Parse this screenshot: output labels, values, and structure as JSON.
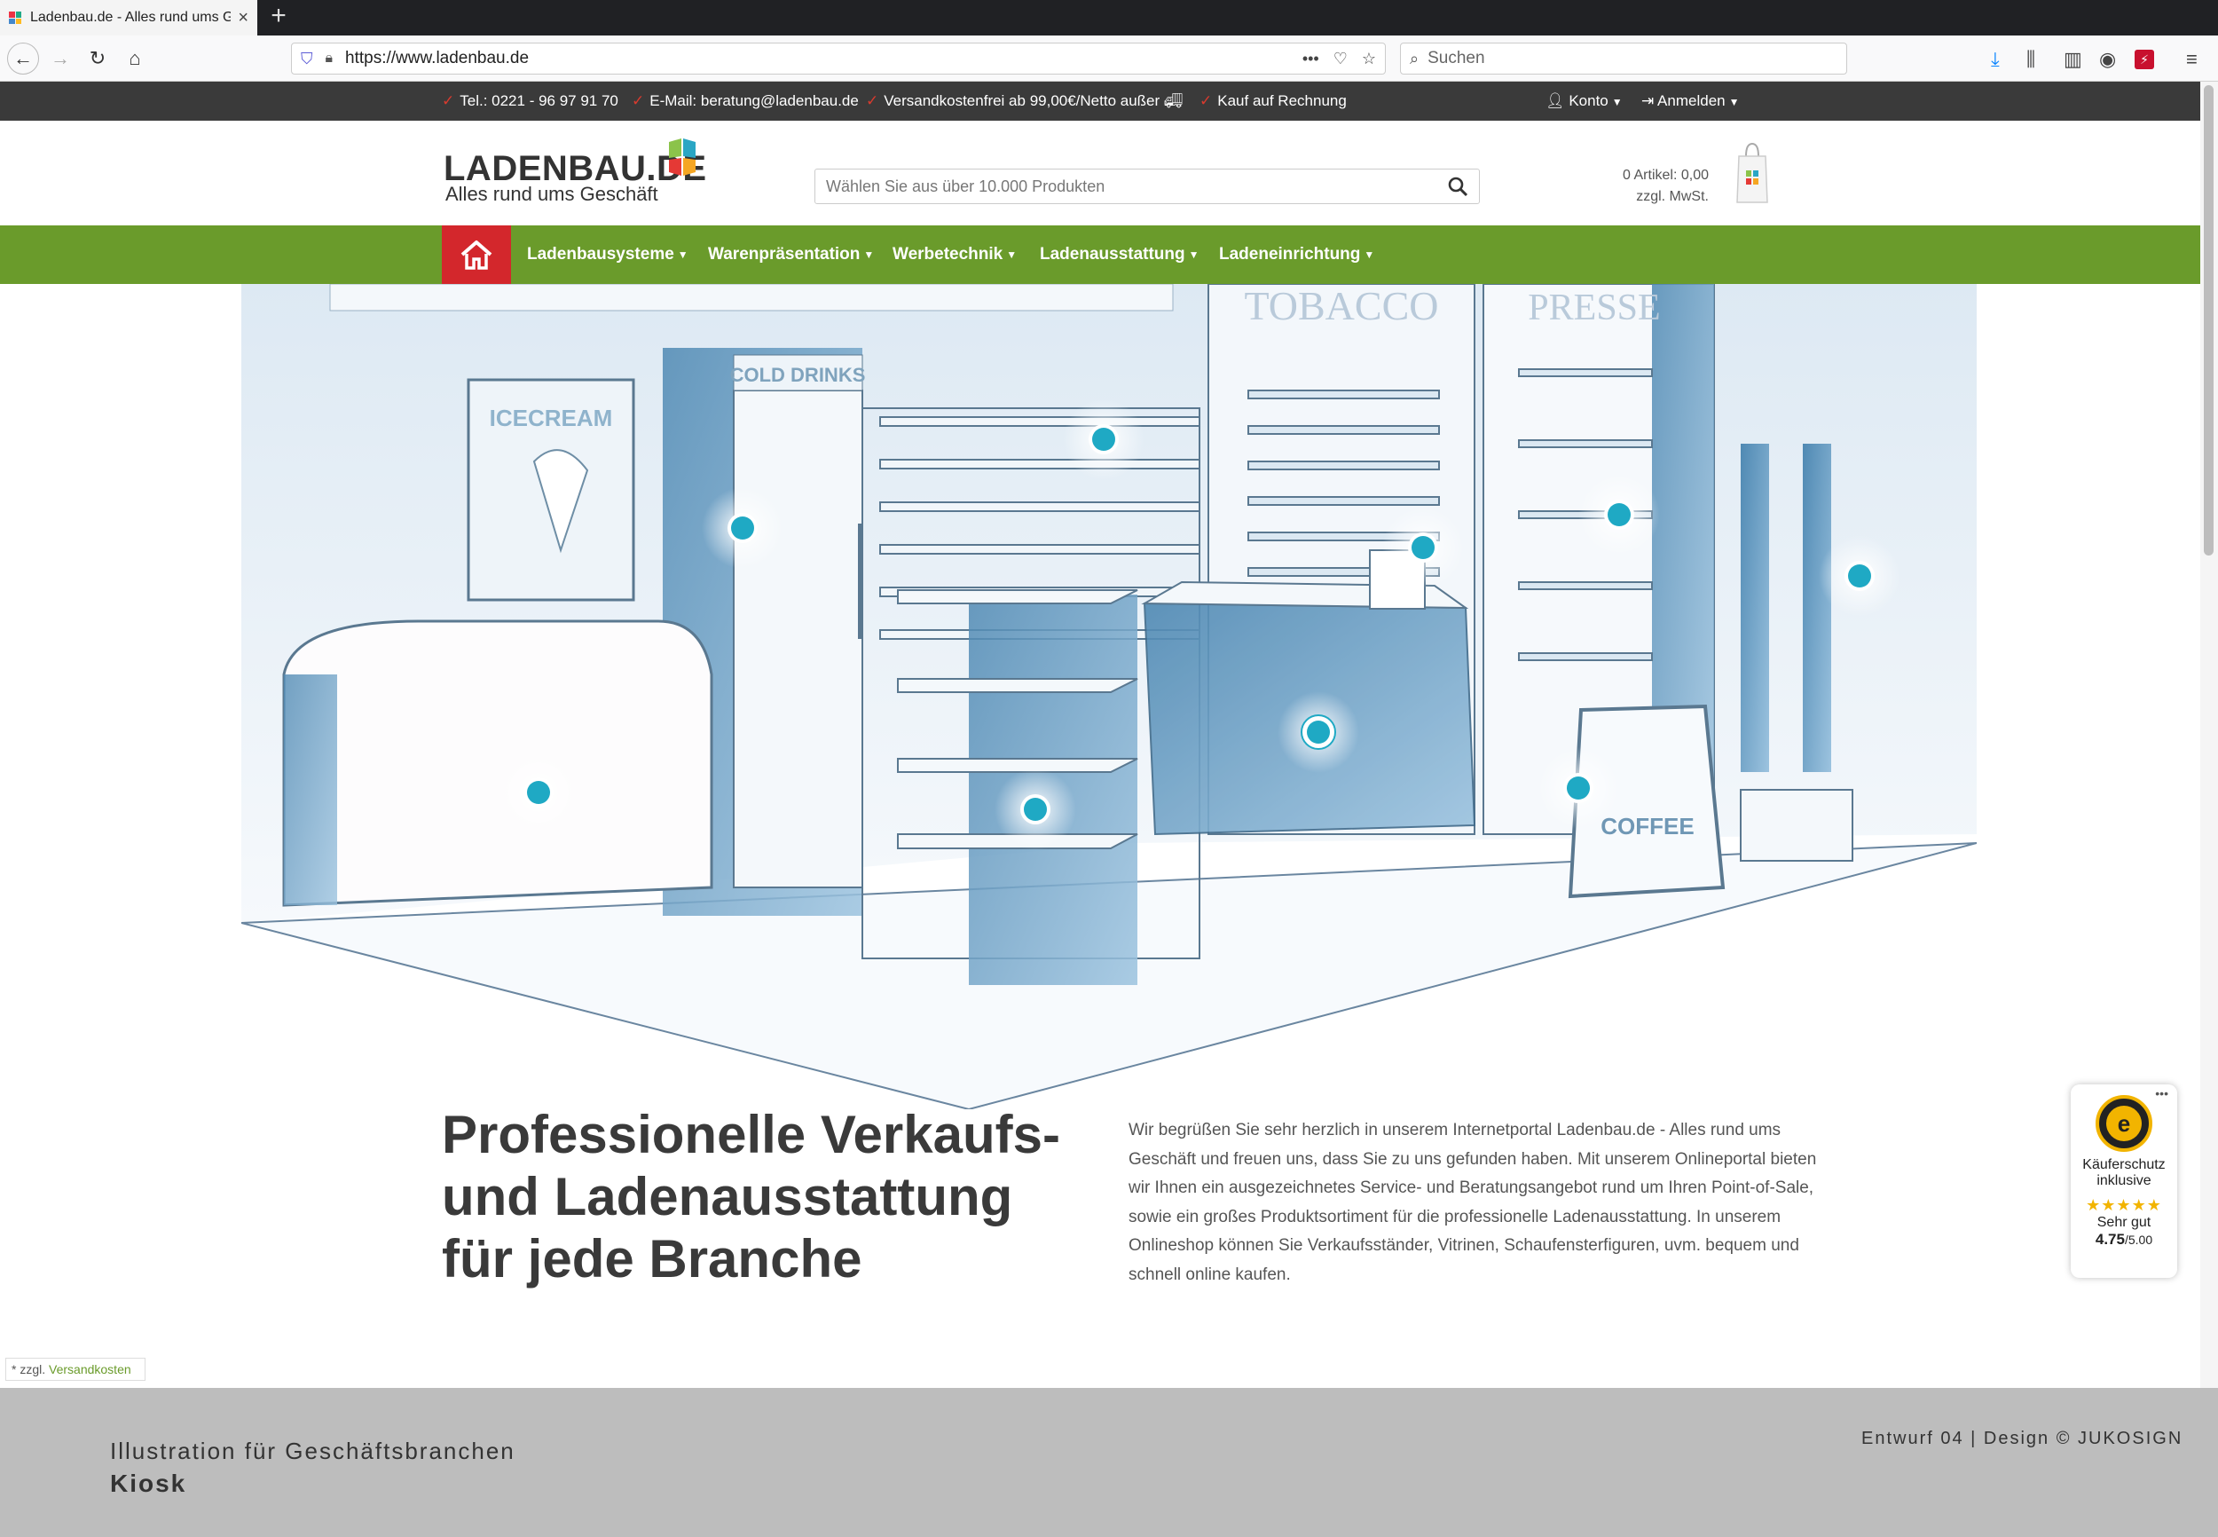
{
  "browser": {
    "tab_title": "Ladenbau.de - Alles rund ums G",
    "url": "https://www.ladenbau.de",
    "search_placeholder": "Suchen",
    "more_icon": "•••"
  },
  "topbar": {
    "phone": "Tel.: 0221 - 96 97 91 70",
    "email": "E-Mail: beratung@ladenbau.de",
    "shipping": "Versandkostenfrei ab 99,00€/Netto außer",
    "invoice": "Kauf auf Rechnung",
    "account": "Konto",
    "login": "Anmelden"
  },
  "header": {
    "logo": "LADENBAU.DE",
    "tagline": "Alles rund ums Geschäft",
    "search_placeholder": "Wählen Sie aus über 10.000 Produkten",
    "cart_line1": "0 Artikel: 0,00",
    "cart_line2": "zzgl. MwSt."
  },
  "nav": {
    "items": [
      "Ladenbausysteme",
      "Warenpräsentation",
      "Werbetechnik",
      "Ladenausstattung",
      "Ladeneinrichtung"
    ]
  },
  "hero": {
    "signs": {
      "tobacco": "TOBACCO",
      "presse": "PRESSE",
      "cold_drinks": "COLD DRINKS",
      "icecream": "ICECREAM",
      "coffee": "COFFEE"
    }
  },
  "content": {
    "headline": "Professionelle Verkaufs- und Ladenausstattung für jede Branche",
    "intro": "Wir begrüßen Sie sehr herzlich in unserem Internetportal Ladenbau.de - Alles rund ums Geschäft und freuen uns, dass Sie zu uns gefunden haben. Mit unserem Onlineportal bieten wir Ihnen ein ausgezeichnetes Service- und Beratungsangebot rund um Ihren Point-of-Sale, sowie ein großes Produktsortiment für die professionelle Ladenausstattung. In unserem Onlineshop können Sie Verkaufsständer, Vitrinen, Schaufensterfiguren, uvm. bequem und schnell online kaufen.",
    "footnote_prefix": "* zzgl.",
    "footnote_link": "Versandkosten"
  },
  "trusted": {
    "dots": "•••",
    "seal_letter": "e",
    "line1": "Käuferschutz",
    "line2": "inklusive",
    "stars": "★★★★★",
    "rating_label": "Sehr gut",
    "rating": "4.75",
    "rating_max": "/5.00"
  },
  "band": {
    "line1": "Illustration für Geschäftsbranchen",
    "line2": "Kiosk",
    "right": "Entwurf 04 | Design © JUKOSIGN"
  },
  "colors": {
    "nav_green": "#6a9b2b",
    "home_red": "#d3272c",
    "topbar": "#3a3a3a",
    "hotspot": "#1fa9c4",
    "band": "#bdbdbd"
  }
}
